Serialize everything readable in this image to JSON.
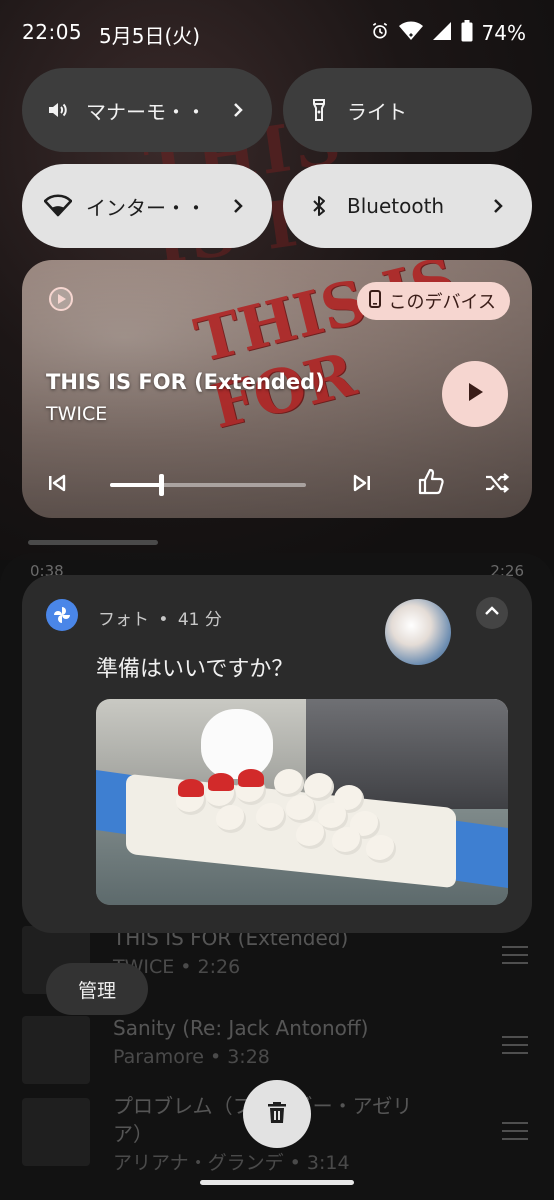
{
  "status_bar": {
    "time": "22:05",
    "date": "5月5日(火)",
    "battery_percent": "74%",
    "icons": [
      "alarm-icon",
      "wifi-icon",
      "signal-icon",
      "battery-icon"
    ]
  },
  "quick_tiles": [
    {
      "label": "マナーモ・・",
      "icon": "speaker-icon",
      "state": "off",
      "has_chevron": true
    },
    {
      "label": "ライト",
      "icon": "flashlight-icon",
      "state": "off",
      "has_chevron": false
    },
    {
      "label": "インター・・",
      "icon": "wifi-icon",
      "state": "on",
      "has_chevron": true
    },
    {
      "label": "Bluetooth",
      "icon": "bluetooth-icon",
      "state": "on",
      "has_chevron": true
    }
  ],
  "media": {
    "device_label": "このデバイス",
    "title": "THIS IS FOR (Extended)",
    "artist": "TWICE",
    "artwork_text": "THIS IS FOR",
    "progress": 0.26,
    "accent": "#f6d6d0"
  },
  "behind_times": {
    "left": "0:38",
    "right": "2:26"
  },
  "notification": {
    "app_name": "フォト",
    "time_ago": "41 分",
    "separator": "•",
    "message": "準備はいいですか？",
    "app_color": "#4a86e8"
  },
  "background_list": [
    {
      "title": "THIS IS FOR (Extended)",
      "subtitle": "TWICE • 2:26"
    },
    {
      "title": "Sanity (Re: Jack Antonoff)",
      "subtitle": "Paramore • 3:28"
    },
    {
      "title": "プロブレム（ファイギー・アゼリ",
      "title2": "ア）",
      "subtitle": "アリアナ・グランデ • 3:14"
    }
  ],
  "manage_label": "管理"
}
